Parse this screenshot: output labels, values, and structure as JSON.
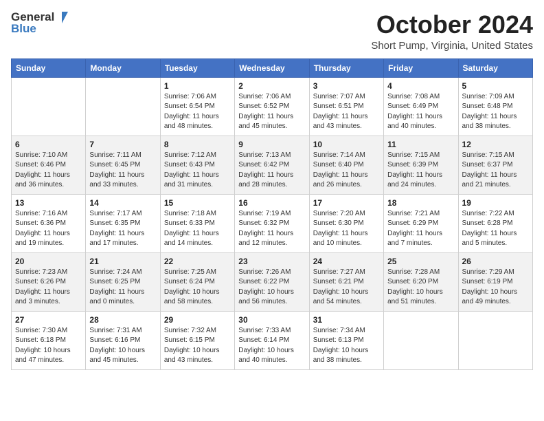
{
  "header": {
    "logo_general": "General",
    "logo_blue": "Blue",
    "month_title": "October 2024",
    "location": "Short Pump, Virginia, United States"
  },
  "days_of_week": [
    "Sunday",
    "Monday",
    "Tuesday",
    "Wednesday",
    "Thursday",
    "Friday",
    "Saturday"
  ],
  "weeks": [
    [
      {
        "day": "",
        "content": ""
      },
      {
        "day": "",
        "content": ""
      },
      {
        "day": "1",
        "content": "Sunrise: 7:06 AM\nSunset: 6:54 PM\nDaylight: 11 hours and 48 minutes."
      },
      {
        "day": "2",
        "content": "Sunrise: 7:06 AM\nSunset: 6:52 PM\nDaylight: 11 hours and 45 minutes."
      },
      {
        "day": "3",
        "content": "Sunrise: 7:07 AM\nSunset: 6:51 PM\nDaylight: 11 hours and 43 minutes."
      },
      {
        "day": "4",
        "content": "Sunrise: 7:08 AM\nSunset: 6:49 PM\nDaylight: 11 hours and 40 minutes."
      },
      {
        "day": "5",
        "content": "Sunrise: 7:09 AM\nSunset: 6:48 PM\nDaylight: 11 hours and 38 minutes."
      }
    ],
    [
      {
        "day": "6",
        "content": "Sunrise: 7:10 AM\nSunset: 6:46 PM\nDaylight: 11 hours and 36 minutes."
      },
      {
        "day": "7",
        "content": "Sunrise: 7:11 AM\nSunset: 6:45 PM\nDaylight: 11 hours and 33 minutes."
      },
      {
        "day": "8",
        "content": "Sunrise: 7:12 AM\nSunset: 6:43 PM\nDaylight: 11 hours and 31 minutes."
      },
      {
        "day": "9",
        "content": "Sunrise: 7:13 AM\nSunset: 6:42 PM\nDaylight: 11 hours and 28 minutes."
      },
      {
        "day": "10",
        "content": "Sunrise: 7:14 AM\nSunset: 6:40 PM\nDaylight: 11 hours and 26 minutes."
      },
      {
        "day": "11",
        "content": "Sunrise: 7:15 AM\nSunset: 6:39 PM\nDaylight: 11 hours and 24 minutes."
      },
      {
        "day": "12",
        "content": "Sunrise: 7:15 AM\nSunset: 6:37 PM\nDaylight: 11 hours and 21 minutes."
      }
    ],
    [
      {
        "day": "13",
        "content": "Sunrise: 7:16 AM\nSunset: 6:36 PM\nDaylight: 11 hours and 19 minutes."
      },
      {
        "day": "14",
        "content": "Sunrise: 7:17 AM\nSunset: 6:35 PM\nDaylight: 11 hours and 17 minutes."
      },
      {
        "day": "15",
        "content": "Sunrise: 7:18 AM\nSunset: 6:33 PM\nDaylight: 11 hours and 14 minutes."
      },
      {
        "day": "16",
        "content": "Sunrise: 7:19 AM\nSunset: 6:32 PM\nDaylight: 11 hours and 12 minutes."
      },
      {
        "day": "17",
        "content": "Sunrise: 7:20 AM\nSunset: 6:30 PM\nDaylight: 11 hours and 10 minutes."
      },
      {
        "day": "18",
        "content": "Sunrise: 7:21 AM\nSunset: 6:29 PM\nDaylight: 11 hours and 7 minutes."
      },
      {
        "day": "19",
        "content": "Sunrise: 7:22 AM\nSunset: 6:28 PM\nDaylight: 11 hours and 5 minutes."
      }
    ],
    [
      {
        "day": "20",
        "content": "Sunrise: 7:23 AM\nSunset: 6:26 PM\nDaylight: 11 hours and 3 minutes."
      },
      {
        "day": "21",
        "content": "Sunrise: 7:24 AM\nSunset: 6:25 PM\nDaylight: 11 hours and 0 minutes."
      },
      {
        "day": "22",
        "content": "Sunrise: 7:25 AM\nSunset: 6:24 PM\nDaylight: 10 hours and 58 minutes."
      },
      {
        "day": "23",
        "content": "Sunrise: 7:26 AM\nSunset: 6:22 PM\nDaylight: 10 hours and 56 minutes."
      },
      {
        "day": "24",
        "content": "Sunrise: 7:27 AM\nSunset: 6:21 PM\nDaylight: 10 hours and 54 minutes."
      },
      {
        "day": "25",
        "content": "Sunrise: 7:28 AM\nSunset: 6:20 PM\nDaylight: 10 hours and 51 minutes."
      },
      {
        "day": "26",
        "content": "Sunrise: 7:29 AM\nSunset: 6:19 PM\nDaylight: 10 hours and 49 minutes."
      }
    ],
    [
      {
        "day": "27",
        "content": "Sunrise: 7:30 AM\nSunset: 6:18 PM\nDaylight: 10 hours and 47 minutes."
      },
      {
        "day": "28",
        "content": "Sunrise: 7:31 AM\nSunset: 6:16 PM\nDaylight: 10 hours and 45 minutes."
      },
      {
        "day": "29",
        "content": "Sunrise: 7:32 AM\nSunset: 6:15 PM\nDaylight: 10 hours and 43 minutes."
      },
      {
        "day": "30",
        "content": "Sunrise: 7:33 AM\nSunset: 6:14 PM\nDaylight: 10 hours and 40 minutes."
      },
      {
        "day": "31",
        "content": "Sunrise: 7:34 AM\nSunset: 6:13 PM\nDaylight: 10 hours and 38 minutes."
      },
      {
        "day": "",
        "content": ""
      },
      {
        "day": "",
        "content": ""
      }
    ]
  ]
}
